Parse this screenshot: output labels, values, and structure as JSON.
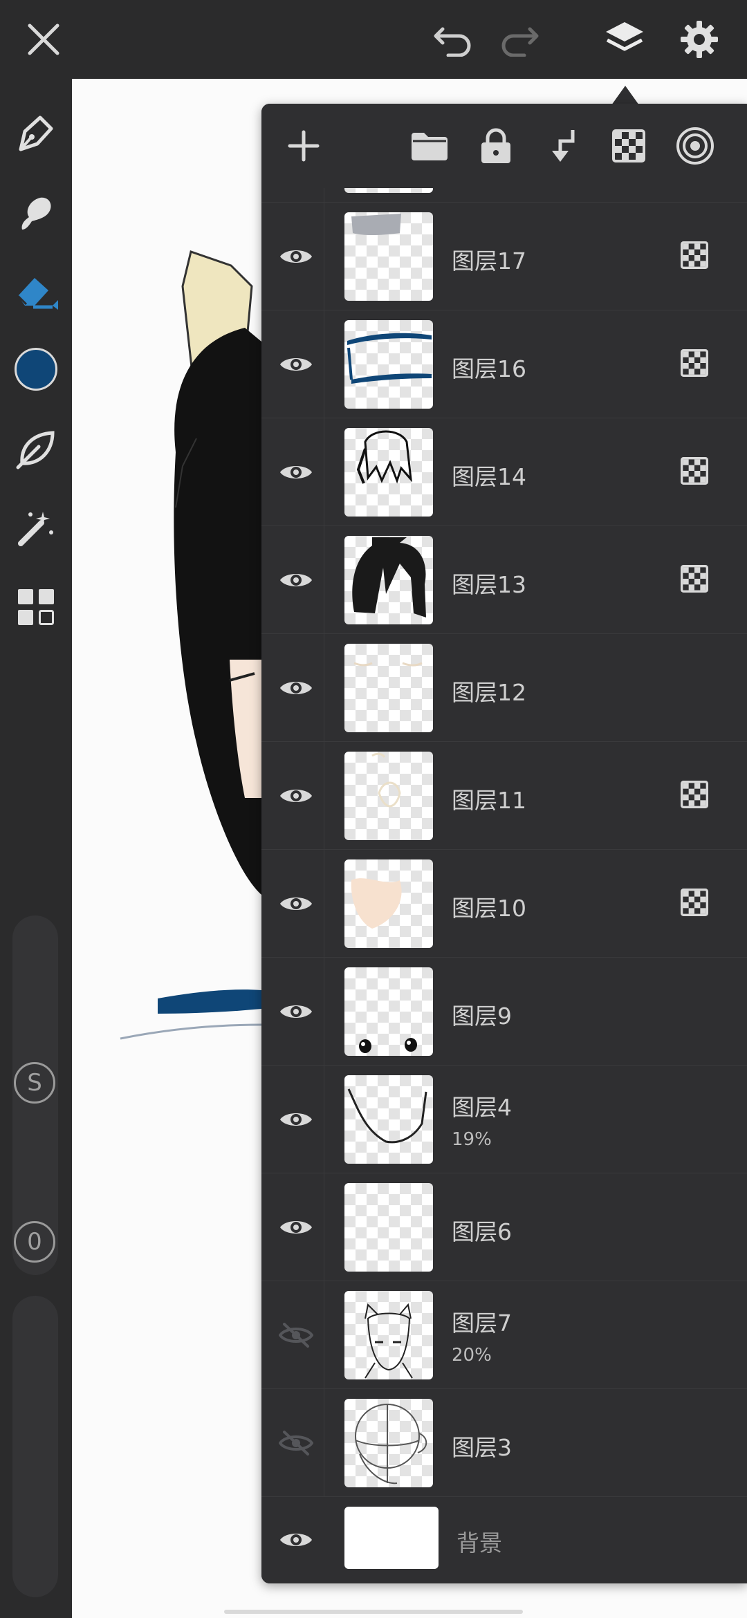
{
  "top_bar": {
    "icons": [
      "close-icon",
      "undo-icon",
      "redo-icon",
      "layers-icon",
      "gear-icon"
    ]
  },
  "left_toolbar": {
    "tools": [
      "pen-icon",
      "smudge-icon",
      "eraser-icon",
      "color-swatch",
      "leaf-shape-icon",
      "magic-wand-icon",
      "grid-icon"
    ],
    "active_tool": "eraser-icon",
    "color": "#0f4677",
    "size_label": "S",
    "opacity_label": "0"
  },
  "layers_panel": {
    "toolbar_icons": [
      "add-icon",
      "folder-icon",
      "lock-icon",
      "merge-down-icon",
      "alpha-lock-icon",
      "blend-mode-icon"
    ],
    "layers": [
      {
        "name": "图层17",
        "opacity": "",
        "visible": true,
        "alpha_lock": true
      },
      {
        "name": "图层16",
        "opacity": "",
        "visible": true,
        "alpha_lock": true
      },
      {
        "name": "图层14",
        "opacity": "",
        "visible": true,
        "alpha_lock": true
      },
      {
        "name": "图层13",
        "opacity": "",
        "visible": true,
        "alpha_lock": true
      },
      {
        "name": "图层12",
        "opacity": "",
        "visible": true,
        "alpha_lock": false
      },
      {
        "name": "图层11",
        "opacity": "",
        "visible": true,
        "alpha_lock": true
      },
      {
        "name": "图层10",
        "opacity": "",
        "visible": true,
        "alpha_lock": true
      },
      {
        "name": "图层9",
        "opacity": "",
        "visible": true,
        "alpha_lock": false
      },
      {
        "name": "图层4",
        "opacity": "19%",
        "visible": true,
        "alpha_lock": false
      },
      {
        "name": "图层6",
        "opacity": "",
        "visible": true,
        "alpha_lock": false
      },
      {
        "name": "图层7",
        "opacity": "20%",
        "visible": false,
        "alpha_lock": false
      },
      {
        "name": "图层3",
        "opacity": "",
        "visible": false,
        "alpha_lock": false
      }
    ],
    "background_layer": {
      "name": "背景",
      "visible": true
    }
  }
}
